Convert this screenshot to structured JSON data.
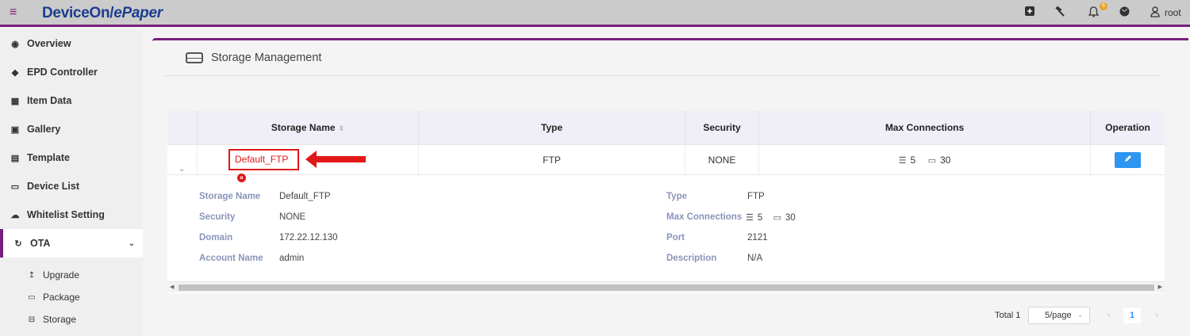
{
  "header": {
    "brand_main": "DeviceOn/",
    "brand_accent": "ePaper",
    "notification_count": "6",
    "user": "root"
  },
  "sidebar": {
    "items": [
      {
        "label": "Overview",
        "icon": "globe-icon"
      },
      {
        "label": "EPD Controller",
        "icon": "tags-icon"
      },
      {
        "label": "Item Data",
        "icon": "table-icon"
      },
      {
        "label": "Gallery",
        "icon": "image-icon"
      },
      {
        "label": "Template",
        "icon": "id-card-icon"
      },
      {
        "label": "Device List",
        "icon": "monitor-icon"
      },
      {
        "label": "Whitelist Setting",
        "icon": "cloud-upload-icon"
      },
      {
        "label": "OTA",
        "icon": "refresh-icon",
        "expanded": true
      }
    ],
    "sub_items": [
      {
        "label": "Upgrade",
        "icon": "upload-icon"
      },
      {
        "label": "Package",
        "icon": "inbox-icon"
      },
      {
        "label": "Storage",
        "icon": "drive-icon"
      }
    ]
  },
  "page": {
    "title": "Storage Management"
  },
  "table": {
    "columns": [
      "Storage Name",
      "Type",
      "Security",
      "Max Connections",
      "Operation"
    ],
    "rows": [
      {
        "name": "Default_FTP",
        "type": "FTP",
        "security": "NONE",
        "max_conn_a": "5",
        "max_conn_b": "30"
      }
    ]
  },
  "detail": {
    "labels": {
      "storage_name": "Storage Name",
      "security": "Security",
      "domain": "Domain",
      "account_name": "Account Name",
      "type": "Type",
      "max_connections": "Max Connections",
      "port": "Port",
      "description": "Description"
    },
    "values": {
      "storage_name": "Default_FTP",
      "security": "NONE",
      "domain": "172.22.12.130",
      "account_name": "admin",
      "type": "FTP",
      "max_conn_a": "5",
      "max_conn_b": "30",
      "port": "2121",
      "description": "N/A"
    }
  },
  "pagination": {
    "total": "Total 1",
    "page_size": "5/page",
    "current_page": "1"
  },
  "colors": {
    "accent": "#7b1f7b",
    "brand": "#1a3d8f",
    "error": "#e01818",
    "primary_button": "#2e95f0"
  }
}
